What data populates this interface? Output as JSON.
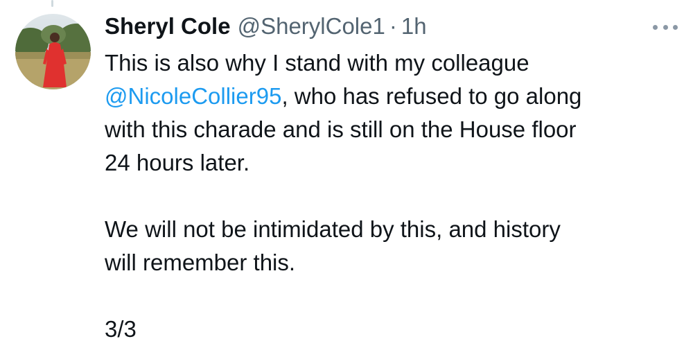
{
  "tweet": {
    "author_name": "Sheryl Cole",
    "handle": "@SherylCole1",
    "separator": "·",
    "time": "1h",
    "body": {
      "line1": "This is also why I stand with my colleague",
      "mention": "@NicoleCollier95",
      "line2_rest": ", who has refused to go along",
      "line3": "with this charade and is still on the House floor",
      "line4": "24 hours later.",
      "para2_line1": "We will not be intimidated by this, and history",
      "para2_line2": "will remember this.",
      "counter": "3/3"
    }
  },
  "icons": {
    "more": "more-horizontal-icon",
    "avatar": "profile-photo"
  },
  "colors": {
    "text": "#0f1419",
    "secondary": "#536471",
    "link": "#1d9bf0",
    "more_dots": "#8b98a5",
    "avatar_dress": "#e0312f"
  }
}
